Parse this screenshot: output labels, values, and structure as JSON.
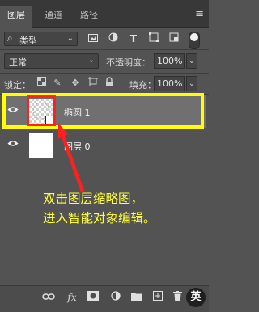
{
  "tabs": [
    {
      "label": "图层",
      "active": true
    },
    {
      "label": "通道",
      "active": false
    },
    {
      "label": "路径",
      "active": false
    }
  ],
  "panel_menu_icon": "menu-lines-icon",
  "filter": {
    "kind_label": "类型",
    "icons": [
      "image-filter-icon",
      "adjustment-filter-icon",
      "text-filter-icon",
      "shape-filter-icon",
      "smart-object-filter-icon"
    ],
    "toggle_on": true
  },
  "blend": {
    "mode": "正常",
    "opacity_label": "不透明度：",
    "opacity_value": "100%"
  },
  "lock": {
    "label": "锁定：",
    "icons": [
      "lock-transparent-icon",
      "lock-image-icon",
      "lock-position-icon",
      "lock-artboard-icon",
      "lock-all-icon"
    ],
    "fill_label": "填充：",
    "fill_value": "100%"
  },
  "layers": [
    {
      "name": "椭圆 1",
      "visible": true,
      "selected": true,
      "type": "smart-object"
    },
    {
      "name": "图层 0",
      "visible": true,
      "selected": false,
      "type": "pixel"
    }
  ],
  "annotation": {
    "line1": "双击图层缩略图，",
    "line2": "进入智能对象编辑。"
  },
  "highlight_color": "#ffff00",
  "ring_color": "#ff2020",
  "bottom_icons": [
    "link-icon",
    "fx-icon",
    "mask-icon",
    "adjustment-icon",
    "folder-icon",
    "new-layer-icon",
    "trash-icon"
  ],
  "ime_badge": "英"
}
